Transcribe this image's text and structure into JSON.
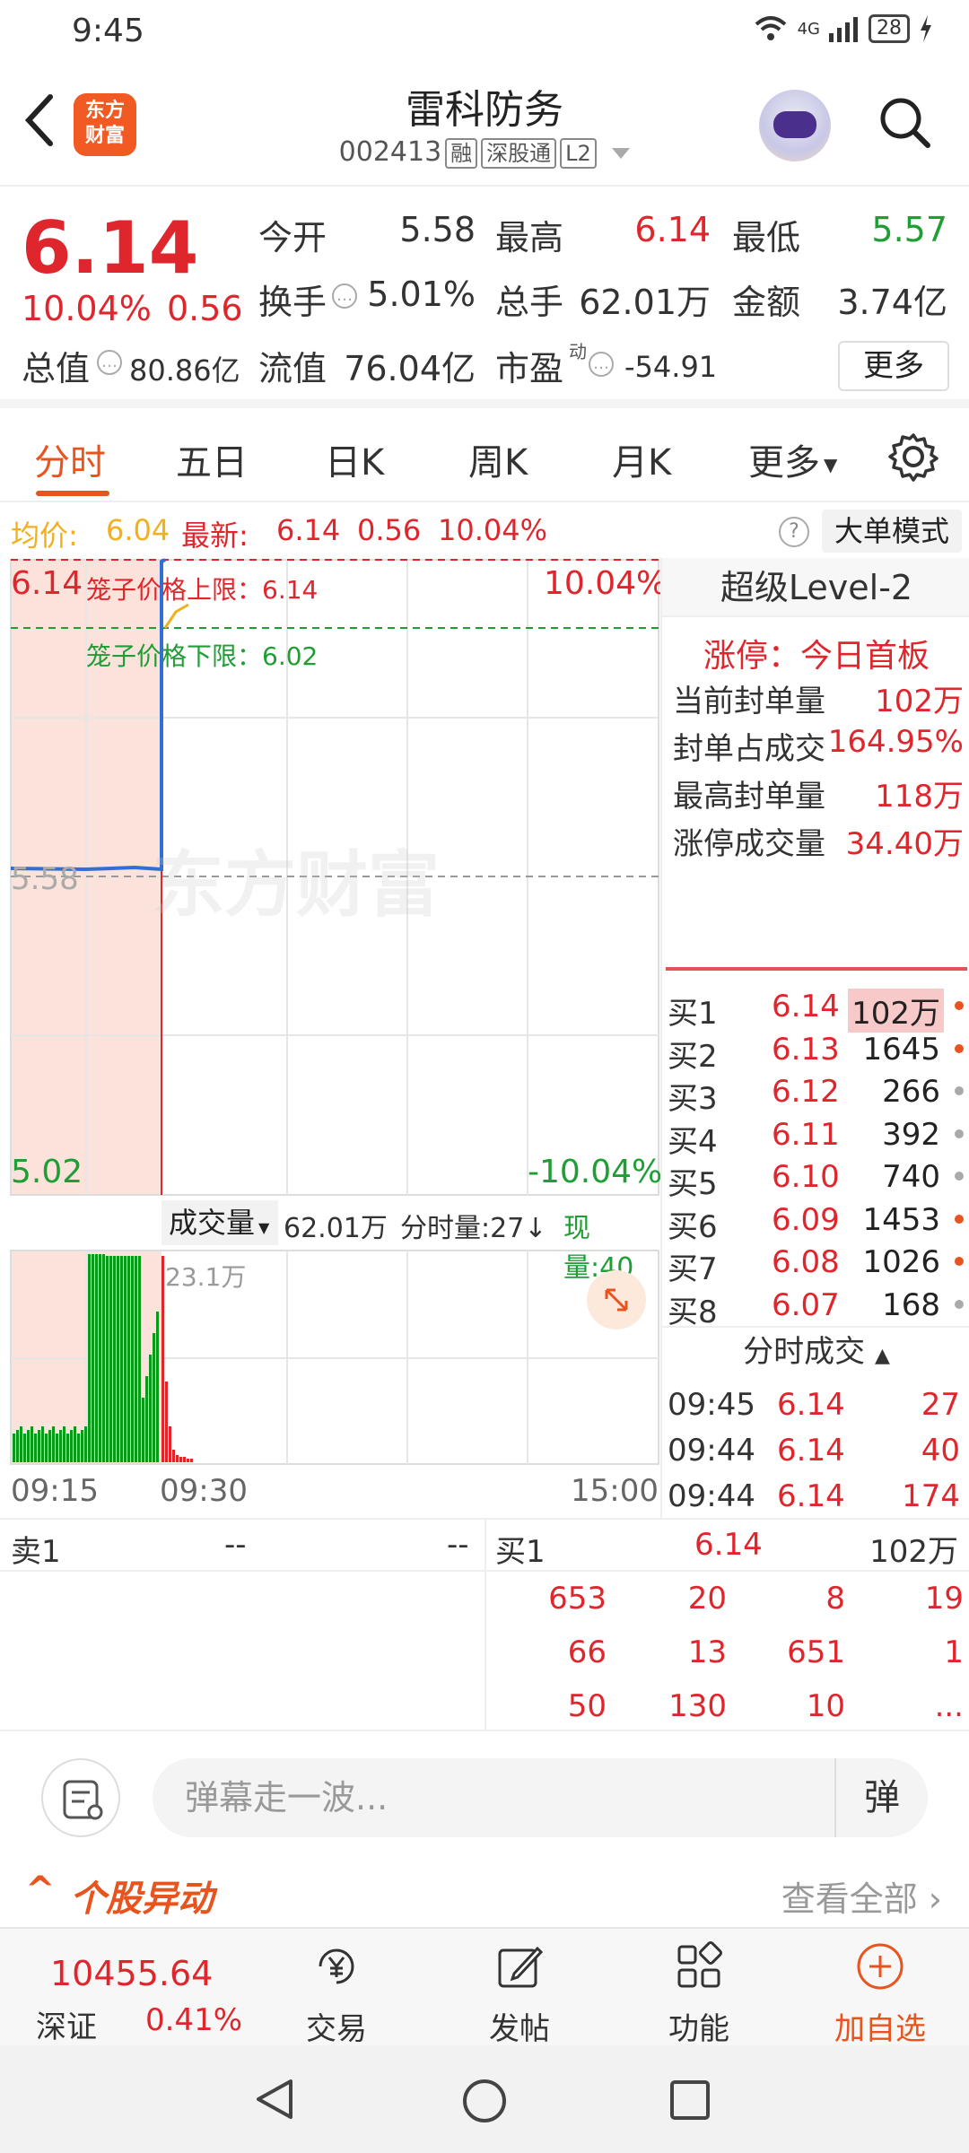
{
  "status": {
    "time": "9:45",
    "network": "4G",
    "battery": "28"
  },
  "header": {
    "logo_line1": "东方",
    "logo_line2": "财富",
    "name": "雷科防务",
    "code": "002413",
    "tags": [
      "融",
      "深股通",
      "L2"
    ]
  },
  "quote": {
    "price": "6.14",
    "change_pct": "10.04%",
    "change": "0.56",
    "open_label": "今开",
    "open": "5.58",
    "high_label": "最高",
    "high": "6.14",
    "low_label": "最低",
    "low": "5.57",
    "turnover_label": "换手",
    "turnover": "5.01%",
    "volume_label": "总手",
    "volume": "62.01万",
    "amount_label": "金额",
    "amount": "3.74亿",
    "mktcap_label": "总值",
    "mktcap": "80.86亿",
    "float_label": "流值",
    "float_val": "76.04亿",
    "pe_label": "市盈",
    "pe_sup": "动",
    "pe": "-54.91",
    "more": "更多"
  },
  "tabs": [
    "分时",
    "五日",
    "日K",
    "周K",
    "月K",
    "更多"
  ],
  "avg": {
    "avg_label": "均价:",
    "avg": "6.04",
    "latest_label": "最新:",
    "latest": "6.14",
    "latest_chg": "0.56",
    "latest_pct": "10.04%",
    "big_order": "大单模式"
  },
  "chart": {
    "top_price": "6.14",
    "top_pct": "10.04%",
    "mid_price": "5.58",
    "bottom_price": "5.02",
    "bottom_pct": "-10.04%",
    "upper_limit": "笼子价格上限：6.14",
    "lower_limit": "笼子价格下限：6.02",
    "watermark": "东方财富",
    "vol_selector": "成交量",
    "vol_total": "62.01万",
    "vol_minute": "分时量:27",
    "vol_now": "现量:40",
    "vol_max": "23.1万",
    "t_start": "09:15",
    "t_open": "09:30",
    "t_end": "15:00"
  },
  "right_panel": {
    "title": "超级Level-2",
    "limit_up": "涨停：今日首板",
    "rows": [
      {
        "label": "当前封单量",
        "value": "102万"
      },
      {
        "label": "封单占成交",
        "value": "164.95%"
      },
      {
        "label": "最高封单量",
        "value": "118万"
      },
      {
        "label": "涨停成交量",
        "value": "34.40万"
      }
    ],
    "book": [
      {
        "label": "买1",
        "price": "6.14",
        "qty": "102万",
        "dot": "#e8541e"
      },
      {
        "label": "买2",
        "price": "6.13",
        "qty": "1645",
        "dot": "#e8541e"
      },
      {
        "label": "买3",
        "price": "6.12",
        "qty": "266",
        "dot": "#aaaaaa"
      },
      {
        "label": "买4",
        "price": "6.11",
        "qty": "392",
        "dot": "#aaaaaa"
      },
      {
        "label": "买5",
        "price": "6.10",
        "qty": "740",
        "dot": "#aaaaaa"
      },
      {
        "label": "买6",
        "price": "6.09",
        "qty": "1453",
        "dot": "#e8541e"
      },
      {
        "label": "买7",
        "price": "6.08",
        "qty": "1026",
        "dot": "#e8541e"
      },
      {
        "label": "买8",
        "price": "6.07",
        "qty": "168",
        "dot": "#aaaaaa"
      }
    ],
    "ticks_title": "分时成交",
    "ticks": [
      {
        "time": "09:45",
        "price": "6.14",
        "qty": "27"
      },
      {
        "time": "09:44",
        "price": "6.14",
        "qty": "40"
      },
      {
        "time": "09:44",
        "price": "6.14",
        "qty": "174"
      }
    ]
  },
  "order_book": {
    "sell_label": "卖1",
    "sell_price": "--",
    "sell_qty": "--",
    "buy_label": "买1",
    "buy_price": "6.14",
    "buy_qty": "102万",
    "queue": [
      [
        "653",
        "20",
        "8",
        "19"
      ],
      [
        "66",
        "13",
        "651",
        "1"
      ],
      [
        "50",
        "130",
        "10",
        "..."
      ]
    ]
  },
  "danmaku": {
    "placeholder": "弹幕走一波...",
    "button": "弹"
  },
  "movement": {
    "title": "个股异动",
    "more": "查看全部"
  },
  "bottom_nav": {
    "index_value": "10455.64",
    "index_name": "深证",
    "index_pct": "0.41%",
    "items": [
      "交易",
      "发帖",
      "功能",
      "加自选"
    ]
  },
  "colors": {
    "up": "#e0262d",
    "down": "#1f9e35",
    "accent": "#e8541e",
    "price_line": "#2f6fd6",
    "avg_line": "#f2b01e"
  }
}
